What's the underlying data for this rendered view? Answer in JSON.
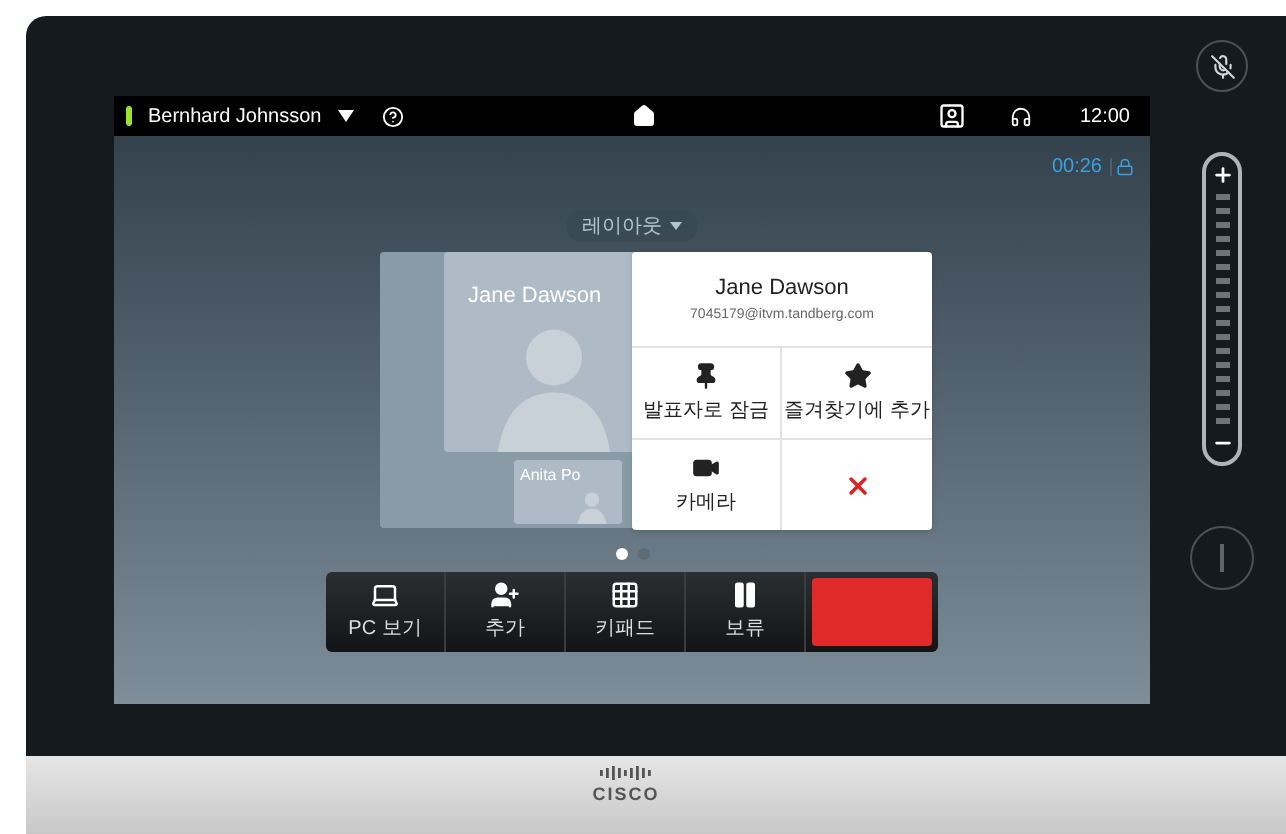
{
  "status_bar": {
    "user": "Bernhard Johnsson",
    "time": "12:00"
  },
  "call": {
    "duration": "00:26",
    "secure": true
  },
  "layout_button": {
    "label": "레이아웃"
  },
  "participants": [
    {
      "name": "Jane Dawson"
    },
    {
      "name": "Anita Po"
    }
  ],
  "popup": {
    "name": "Jane Dawson",
    "address": "7045179@itvm.tandberg.com",
    "actions": [
      {
        "kind": "pin",
        "label": "발표자로 잠금"
      },
      {
        "kind": "favorite",
        "label": "즐겨찾기에 추가"
      },
      {
        "kind": "camera",
        "label": "카메라"
      },
      {
        "kind": "remove"
      }
    ]
  },
  "pages": [
    {
      "selected": true
    },
    {
      "selected": false
    }
  ],
  "toolbar": [
    {
      "kind": "share",
      "label": "PC 보기"
    },
    {
      "kind": "add",
      "label": "추가"
    },
    {
      "kind": "keypad",
      "label": "키패드"
    },
    {
      "kind": "hold",
      "label": "보류"
    },
    {
      "kind": "end"
    }
  ],
  "side": {
    "muted": true
  },
  "brand": "CISCO"
}
